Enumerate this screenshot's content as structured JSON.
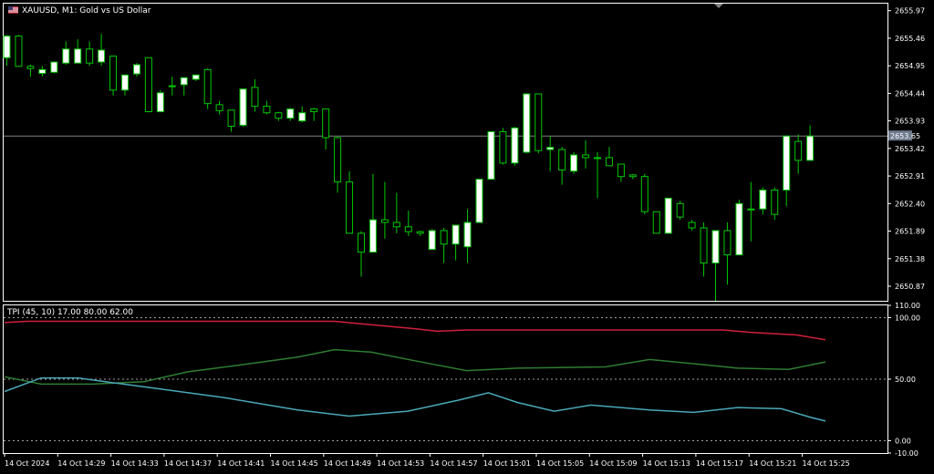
{
  "header": {
    "symbol_title": "XAUUSD, M1:  Gold vs US Dollar",
    "flag_icon": "us-flag-icon"
  },
  "indicator": {
    "title": "TPI (45, 10) 17.00 80.00 62.00"
  },
  "price_axis": {
    "labels": [
      "2655.97",
      "2655.46",
      "2654.95",
      "2654.44",
      "2653.93",
      "2653.42",
      "2652.91",
      "2652.40",
      "2651.89",
      "2651.38",
      "2650.87"
    ],
    "current_price": "2653.65"
  },
  "indicator_axis": {
    "labels": [
      "110.00",
      "100.00",
      "50.00",
      "0.00",
      "-10.00"
    ]
  },
  "time_axis": {
    "labels": [
      "14 Oct 2024",
      "14 Oct 14:29",
      "14 Oct 14:33",
      "14 Oct 14:37",
      "14 Oct 14:41",
      "14 Oct 14:45",
      "14 Oct 14:49",
      "14 Oct 14:53",
      "14 Oct 14:57",
      "14 Oct 15:01",
      "14 Oct 15:05",
      "14 Oct 15:09",
      "14 Oct 15:13",
      "14 Oct 15:17",
      "14 Oct 15:21",
      "14 Oct 15:25"
    ]
  },
  "colors": {
    "background": "#000000",
    "grid": "#ffffff",
    "bull_body": "#ffffff",
    "bear_body": "#000000",
    "candle_outline": "#00c800",
    "current_price_line": "#808080",
    "current_price_box": "#6e7b8e",
    "red_line": "#d0203c",
    "green_line": "#2e7d32",
    "cyan_line": "#4aa8b8",
    "level_line": "#a0a0a0"
  },
  "chart_data": [
    {
      "type": "candlestick",
      "title": "XAUUSD, M1:  Gold vs US Dollar",
      "ylim": [
        2650.6,
        2656.1
      ],
      "current_price": 2653.65,
      "candles": [
        {
          "o": 2655.1,
          "h": 2655.52,
          "l": 2654.95,
          "c": 2655.5
        },
        {
          "o": 2655.5,
          "h": 2655.52,
          "l": 2654.93,
          "c": 2654.94
        },
        {
          "o": 2654.94,
          "h": 2654.97,
          "l": 2654.75,
          "c": 2654.9
        },
        {
          "o": 2654.81,
          "h": 2654.95,
          "l": 2654.75,
          "c": 2654.88
        },
        {
          "o": 2654.83,
          "h": 2655.02,
          "l": 2654.81,
          "c": 2655.02
        },
        {
          "o": 2655.0,
          "h": 2655.4,
          "l": 2654.97,
          "c": 2655.26
        },
        {
          "o": 2655.0,
          "h": 2655.44,
          "l": 2655.0,
          "c": 2655.26
        },
        {
          "o": 2655.26,
          "h": 2655.4,
          "l": 2654.95,
          "c": 2655.0
        },
        {
          "o": 2655.02,
          "h": 2655.54,
          "l": 2654.95,
          "c": 2655.24
        },
        {
          "o": 2655.13,
          "h": 2655.13,
          "l": 2654.4,
          "c": 2654.5
        },
        {
          "o": 2654.5,
          "h": 2654.78,
          "l": 2654.4,
          "c": 2654.78
        },
        {
          "o": 2654.8,
          "h": 2655.0,
          "l": 2654.75,
          "c": 2654.97
        },
        {
          "o": 2655.1,
          "h": 2655.1,
          "l": 2654.1,
          "c": 2654.1
        },
        {
          "o": 2654.1,
          "h": 2654.5,
          "l": 2654.1,
          "c": 2654.45
        },
        {
          "o": 2654.58,
          "h": 2654.75,
          "l": 2654.4,
          "c": 2654.58
        },
        {
          "o": 2654.6,
          "h": 2654.73,
          "l": 2654.4,
          "c": 2654.73
        },
        {
          "o": 2654.7,
          "h": 2654.78,
          "l": 2654.67,
          "c": 2654.78
        },
        {
          "o": 2654.88,
          "h": 2654.9,
          "l": 2654.15,
          "c": 2654.25
        },
        {
          "o": 2654.23,
          "h": 2654.3,
          "l": 2654.05,
          "c": 2654.12
        },
        {
          "o": 2654.13,
          "h": 2654.13,
          "l": 2653.73,
          "c": 2653.83
        },
        {
          "o": 2653.85,
          "h": 2654.53,
          "l": 2653.82,
          "c": 2654.52
        },
        {
          "o": 2654.55,
          "h": 2654.7,
          "l": 2654.1,
          "c": 2654.2
        },
        {
          "o": 2654.2,
          "h": 2654.3,
          "l": 2654.05,
          "c": 2654.08
        },
        {
          "o": 2654.08,
          "h": 2654.1,
          "l": 2653.93,
          "c": 2653.98
        },
        {
          "o": 2653.98,
          "h": 2654.17,
          "l": 2653.93,
          "c": 2654.15
        },
        {
          "o": 2653.93,
          "h": 2654.2,
          "l": 2653.9,
          "c": 2654.08
        },
        {
          "o": 2654.15,
          "h": 2654.17,
          "l": 2653.93,
          "c": 2654.1
        },
        {
          "o": 2654.15,
          "h": 2654.15,
          "l": 2653.4,
          "c": 2653.62
        },
        {
          "o": 2653.62,
          "h": 2653.64,
          "l": 2652.6,
          "c": 2652.8
        },
        {
          "o": 2652.8,
          "h": 2653.0,
          "l": 2651.85,
          "c": 2651.85
        },
        {
          "o": 2651.85,
          "h": 2651.89,
          "l": 2651.05,
          "c": 2651.5
        },
        {
          "o": 2651.5,
          "h": 2652.95,
          "l": 2651.5,
          "c": 2652.1
        },
        {
          "o": 2652.1,
          "h": 2652.8,
          "l": 2651.75,
          "c": 2652.05
        },
        {
          "o": 2652.05,
          "h": 2652.6,
          "l": 2651.85,
          "c": 2651.97
        },
        {
          "o": 2651.97,
          "h": 2652.27,
          "l": 2651.8,
          "c": 2651.88
        },
        {
          "o": 2651.88,
          "h": 2651.9,
          "l": 2651.8,
          "c": 2651.85
        },
        {
          "o": 2651.55,
          "h": 2651.93,
          "l": 2651.55,
          "c": 2651.9
        },
        {
          "o": 2651.9,
          "h": 2651.95,
          "l": 2651.3,
          "c": 2651.65
        },
        {
          "o": 2651.65,
          "h": 2652.0,
          "l": 2651.35,
          "c": 2652.0
        },
        {
          "o": 2651.6,
          "h": 2652.3,
          "l": 2651.3,
          "c": 2652.05
        },
        {
          "o": 2652.05,
          "h": 2652.85,
          "l": 2652.05,
          "c": 2652.85
        },
        {
          "o": 2652.85,
          "h": 2653.73,
          "l": 2652.85,
          "c": 2653.73
        },
        {
          "o": 2653.73,
          "h": 2653.8,
          "l": 2653.12,
          "c": 2653.15
        },
        {
          "o": 2653.15,
          "h": 2653.82,
          "l": 2653.1,
          "c": 2653.8
        },
        {
          "o": 2653.35,
          "h": 2654.44,
          "l": 2653.33,
          "c": 2654.43
        },
        {
          "o": 2654.43,
          "h": 2654.43,
          "l": 2653.33,
          "c": 2653.38
        },
        {
          "o": 2653.4,
          "h": 2653.65,
          "l": 2653.0,
          "c": 2653.44
        },
        {
          "o": 2653.4,
          "h": 2653.45,
          "l": 2652.75,
          "c": 2653.02
        },
        {
          "o": 2653.0,
          "h": 2653.35,
          "l": 2652.95,
          "c": 2653.3
        },
        {
          "o": 2653.3,
          "h": 2653.57,
          "l": 2653.05,
          "c": 2653.25
        },
        {
          "o": 2653.25,
          "h": 2653.35,
          "l": 2652.5,
          "c": 2653.25
        },
        {
          "o": 2653.25,
          "h": 2653.45,
          "l": 2653.1,
          "c": 2653.1
        },
        {
          "o": 2653.13,
          "h": 2653.13,
          "l": 2652.8,
          "c": 2652.9
        },
        {
          "o": 2652.93,
          "h": 2652.95,
          "l": 2652.85,
          "c": 2652.9
        },
        {
          "o": 2652.9,
          "h": 2652.95,
          "l": 2652.2,
          "c": 2652.25
        },
        {
          "o": 2652.25,
          "h": 2652.25,
          "l": 2651.85,
          "c": 2651.85
        },
        {
          "o": 2651.85,
          "h": 2652.5,
          "l": 2651.85,
          "c": 2652.5
        },
        {
          "o": 2652.4,
          "h": 2652.45,
          "l": 2652.1,
          "c": 2652.15
        },
        {
          "o": 2652.05,
          "h": 2652.1,
          "l": 2651.9,
          "c": 2651.95
        },
        {
          "o": 2651.95,
          "h": 2652.05,
          "l": 2651.05,
          "c": 2651.3
        },
        {
          "o": 2651.3,
          "h": 2651.9,
          "l": 2650.6,
          "c": 2651.9
        },
        {
          "o": 2651.9,
          "h": 2652.05,
          "l": 2650.9,
          "c": 2651.45
        },
        {
          "o": 2651.45,
          "h": 2652.47,
          "l": 2651.45,
          "c": 2652.4
        },
        {
          "o": 2652.3,
          "h": 2652.8,
          "l": 2651.7,
          "c": 2652.3
        },
        {
          "o": 2652.3,
          "h": 2652.7,
          "l": 2652.2,
          "c": 2652.65
        },
        {
          "o": 2652.65,
          "h": 2652.7,
          "l": 2652.1,
          "c": 2652.2
        },
        {
          "o": 2652.65,
          "h": 2653.65,
          "l": 2652.35,
          "c": 2653.65
        },
        {
          "o": 2653.55,
          "h": 2653.68,
          "l": 2652.95,
          "c": 2653.2
        },
        {
          "o": 2653.2,
          "h": 2653.85,
          "l": 2653.2,
          "c": 2653.65
        }
      ]
    },
    {
      "type": "line",
      "title": "TPI (45, 10) 17.00 80.00 62.00",
      "ylim": [
        -10,
        110
      ],
      "levels": [
        100,
        50,
        0
      ],
      "series": [
        {
          "color": "#d0203c",
          "values": [
            {
              "t": 0,
              "v": 96
            },
            {
              "t": 3,
              "v": 97
            },
            {
              "t": 30,
              "v": 97
            },
            {
              "t": 45,
              "v": 97
            },
            {
              "t": 56,
              "v": 91
            },
            {
              "t": 59,
              "v": 89
            },
            {
              "t": 63,
              "v": 90
            },
            {
              "t": 70,
              "v": 90
            },
            {
              "t": 85,
              "v": 90
            },
            {
              "t": 98,
              "v": 90
            },
            {
              "t": 102,
              "v": 88
            },
            {
              "t": 108,
              "v": 86
            },
            {
              "t": 112,
              "v": 82
            }
          ]
        },
        {
          "color": "#2e7d32",
          "values": [
            {
              "t": 0,
              "v": 52
            },
            {
              "t": 5,
              "v": 46
            },
            {
              "t": 12,
              "v": 46
            },
            {
              "t": 19,
              "v": 48
            },
            {
              "t": 25,
              "v": 56
            },
            {
              "t": 34,
              "v": 63
            },
            {
              "t": 40,
              "v": 68
            },
            {
              "t": 45,
              "v": 74
            },
            {
              "t": 50,
              "v": 72
            },
            {
              "t": 56,
              "v": 65
            },
            {
              "t": 63,
              "v": 57
            },
            {
              "t": 70,
              "v": 59
            },
            {
              "t": 82,
              "v": 60
            },
            {
              "t": 88,
              "v": 66
            },
            {
              "t": 95,
              "v": 62
            },
            {
              "t": 100,
              "v": 59
            },
            {
              "t": 107,
              "v": 58
            },
            {
              "t": 112,
              "v": 64
            }
          ]
        },
        {
          "color": "#4aa8b8",
          "values": [
            {
              "t": 0,
              "v": 40
            },
            {
              "t": 5,
              "v": 51
            },
            {
              "t": 10,
              "v": 51
            },
            {
              "t": 15,
              "v": 47
            },
            {
              "t": 20,
              "v": 43
            },
            {
              "t": 30,
              "v": 35
            },
            {
              "t": 40,
              "v": 25
            },
            {
              "t": 47,
              "v": 20
            },
            {
              "t": 55,
              "v": 24
            },
            {
              "t": 62,
              "v": 33
            },
            {
              "t": 66,
              "v": 39
            },
            {
              "t": 70,
              "v": 31
            },
            {
              "t": 75,
              "v": 24
            },
            {
              "t": 80,
              "v": 29
            },
            {
              "t": 88,
              "v": 25
            },
            {
              "t": 94,
              "v": 23
            },
            {
              "t": 100,
              "v": 27
            },
            {
              "t": 106,
              "v": 26
            },
            {
              "t": 110,
              "v": 19
            },
            {
              "t": 112,
              "v": 16
            }
          ]
        }
      ]
    }
  ]
}
